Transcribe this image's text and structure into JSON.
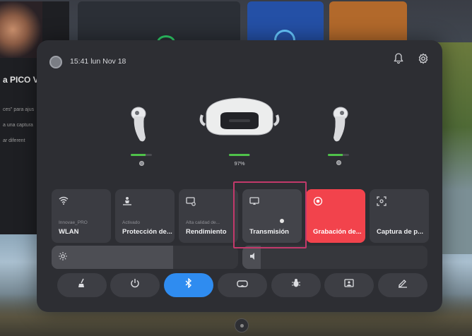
{
  "background": {
    "left_panel_title": "a PICO VI",
    "left_panel_lines": [
      "ces\" para ajus",
      "a una captura",
      "ar diferent"
    ]
  },
  "status_bar": {
    "datetime": "15:41 lun Nov 18",
    "icons": [
      "bell-icon",
      "settings-gear-icon"
    ]
  },
  "devices": {
    "left_controller": {
      "battery_fraction": 0.7,
      "label_icon": "dot"
    },
    "headset": {
      "battery_fraction": 0.97,
      "battery_text": "97%"
    },
    "right_controller": {
      "battery_fraction": 0.7,
      "label_icon": "dot"
    }
  },
  "tiles": [
    {
      "icon": "wifi-icon",
      "sub": "Innovae_PRO",
      "label": "WLAN"
    },
    {
      "icon": "person-protection-icon",
      "sub": "Activado",
      "label": "Protección de..."
    },
    {
      "icon": "performance-icon",
      "sub": "Alta calidad de...",
      "label": "Rendimiento"
    },
    {
      "icon": "cast-icon",
      "sub": "",
      "label": "Transmisión"
    },
    {
      "icon": "record-icon",
      "sub": "",
      "label": "Grabación de..."
    },
    {
      "icon": "screenshot-icon",
      "sub": "",
      "label": "Captura de p..."
    }
  ],
  "sliders": {
    "brightness": {
      "icon": "sun-icon",
      "level": 0.65
    },
    "volume": {
      "icon": "speaker-icon",
      "level": 0.1
    }
  },
  "bottom_buttons": [
    {
      "icon": "cleanup-broom-icon",
      "active": false
    },
    {
      "icon": "power-icon",
      "active": false
    },
    {
      "icon": "bluetooth-icon",
      "active": true
    },
    {
      "icon": "vr-glasses-icon",
      "active": false
    },
    {
      "icon": "bug-icon",
      "active": false
    },
    {
      "icon": "photo-frame-icon",
      "active": false
    },
    {
      "icon": "edit-pen-icon",
      "active": false
    }
  ],
  "colors": {
    "accent_blue": "#2f8cf0",
    "record_red": "#f2434c",
    "battery_green": "#4fc24a",
    "highlight_magenta": "#c3396b"
  }
}
